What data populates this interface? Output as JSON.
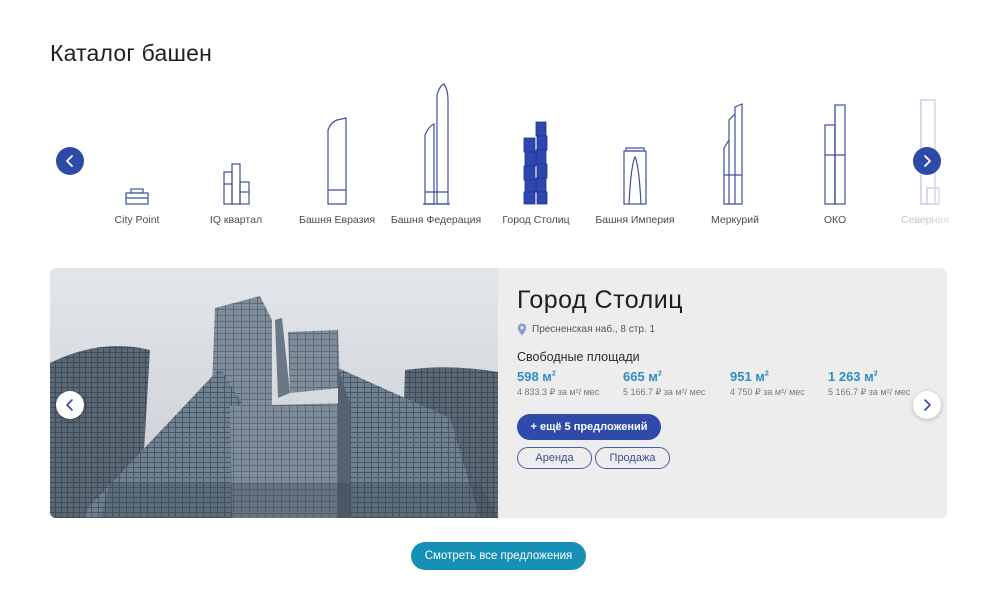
{
  "page": {
    "title": "Каталог башен"
  },
  "carousel": {
    "towers": [
      {
        "label": "City Point"
      },
      {
        "label": "IQ квартал"
      },
      {
        "label": "Башня Евразия"
      },
      {
        "label": "Башня Федерация"
      },
      {
        "label": "Город Столиц",
        "selected": true
      },
      {
        "label": "Башня Империя"
      },
      {
        "label": "Меркурий"
      },
      {
        "label": "ОКО"
      },
      {
        "label": "Северная"
      }
    ],
    "prev_icon": "chevron-left-icon",
    "next_icon": "chevron-right-icon",
    "accent": "#2d4aa8"
  },
  "card": {
    "tower_name": "Город Столиц",
    "address": "Пресненская наб., 8 стр. 1",
    "free_title": "Свободные площади",
    "offers": [
      {
        "area": "598 м",
        "unit_sup": "2",
        "price": "4 833.3 ₽ за м²/ мес"
      },
      {
        "area": "665 м",
        "unit_sup": "2",
        "price": "5 166.7 ₽ за м²/ мес"
      },
      {
        "area": "951 м",
        "unit_sup": "2",
        "price": "4 750 ₽ за м²/ мес"
      },
      {
        "area": "1 263 м",
        "unit_sup": "2",
        "price": "5 166.7 ₽ за м²/ мес"
      }
    ],
    "more_button": "+ ещё 5 предложений",
    "rent_button": "Аренда",
    "sale_button": "Продажа"
  },
  "footer": {
    "view_all_button": "Смотреть все предложения"
  },
  "colors": {
    "primary": "#2f4aa9",
    "teal": "#1790b8",
    "area_blue": "#2b8ec4",
    "card_bg": "#ededee"
  }
}
